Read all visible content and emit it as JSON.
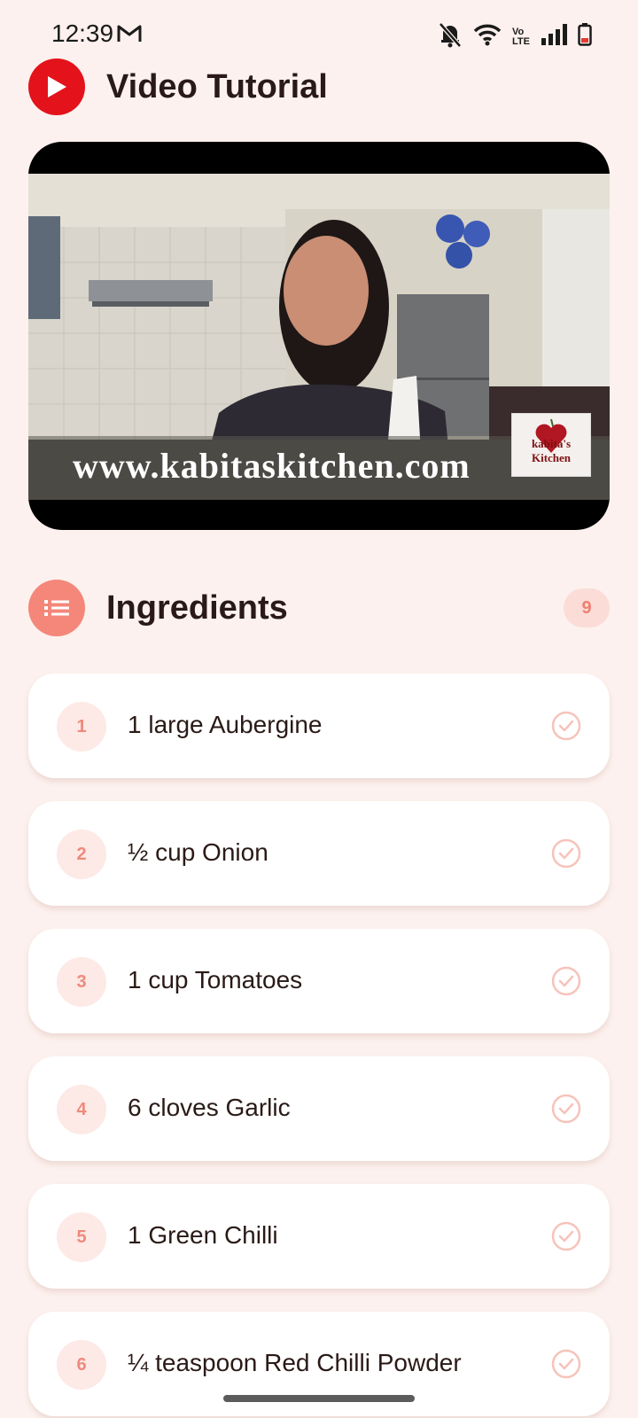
{
  "status_bar": {
    "time": "12:39",
    "icons": [
      "gmail-icon",
      "bell-off-icon",
      "wifi-icon",
      "volte-icon",
      "signal-icon",
      "battery-low-icon"
    ],
    "volte_top": "Vo",
    "volte_bottom": "LTE"
  },
  "video_section": {
    "title": "Video Tutorial",
    "icon": "youtube-play-icon",
    "thumbnail": {
      "watermark_url": "www.kabitaskitchen.com",
      "logo_text": "kabita's Kitchen"
    }
  },
  "ingredients_section": {
    "title": "Ingredients",
    "icon": "list-icon",
    "count": "9",
    "items": [
      {
        "number": "1",
        "text": "1 large Aubergine"
      },
      {
        "number": "2",
        "text": "½ cup Onion"
      },
      {
        "number": "3",
        "text": "1 cup Tomatoes"
      },
      {
        "number": "4",
        "text": "6 cloves Garlic"
      },
      {
        "number": "5",
        "text": "1 Green Chilli"
      },
      {
        "number": "6",
        "text": "¼ teaspoon Red Chilli Powder"
      }
    ]
  },
  "colors": {
    "background": "#FCF1EE",
    "accent": "#F4877A",
    "youtube_red": "#E3121B",
    "badge_bg": "#FBDCD6"
  }
}
